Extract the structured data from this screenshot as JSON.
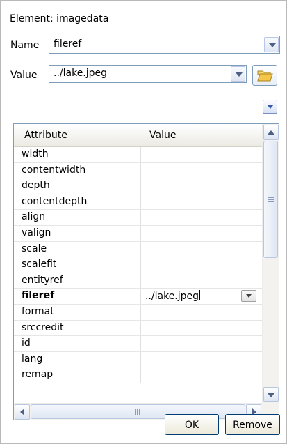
{
  "header": {
    "element_label": "Element: imagedata"
  },
  "name_field": {
    "label": "Name",
    "value": "fileref"
  },
  "value_field": {
    "label": "Value",
    "value": "../lake.jpeg"
  },
  "table": {
    "columns": [
      "Attribute",
      "Value"
    ],
    "rows": [
      {
        "name": "width",
        "value": ""
      },
      {
        "name": "contentwidth",
        "value": ""
      },
      {
        "name": "depth",
        "value": ""
      },
      {
        "name": "contentdepth",
        "value": ""
      },
      {
        "name": "align",
        "value": ""
      },
      {
        "name": "valign",
        "value": ""
      },
      {
        "name": "scale",
        "value": ""
      },
      {
        "name": "scalefit",
        "value": ""
      },
      {
        "name": "entityref",
        "value": ""
      },
      {
        "name": "fileref",
        "value": "../lake.jpeg",
        "selected": true
      },
      {
        "name": "format",
        "value": ""
      },
      {
        "name": "srccredit",
        "value": ""
      },
      {
        "name": "id",
        "value": ""
      },
      {
        "name": "lang",
        "value": ""
      },
      {
        "name": "remap",
        "value": ""
      }
    ]
  },
  "buttons": {
    "ok": "OK",
    "remove": "Remove"
  }
}
